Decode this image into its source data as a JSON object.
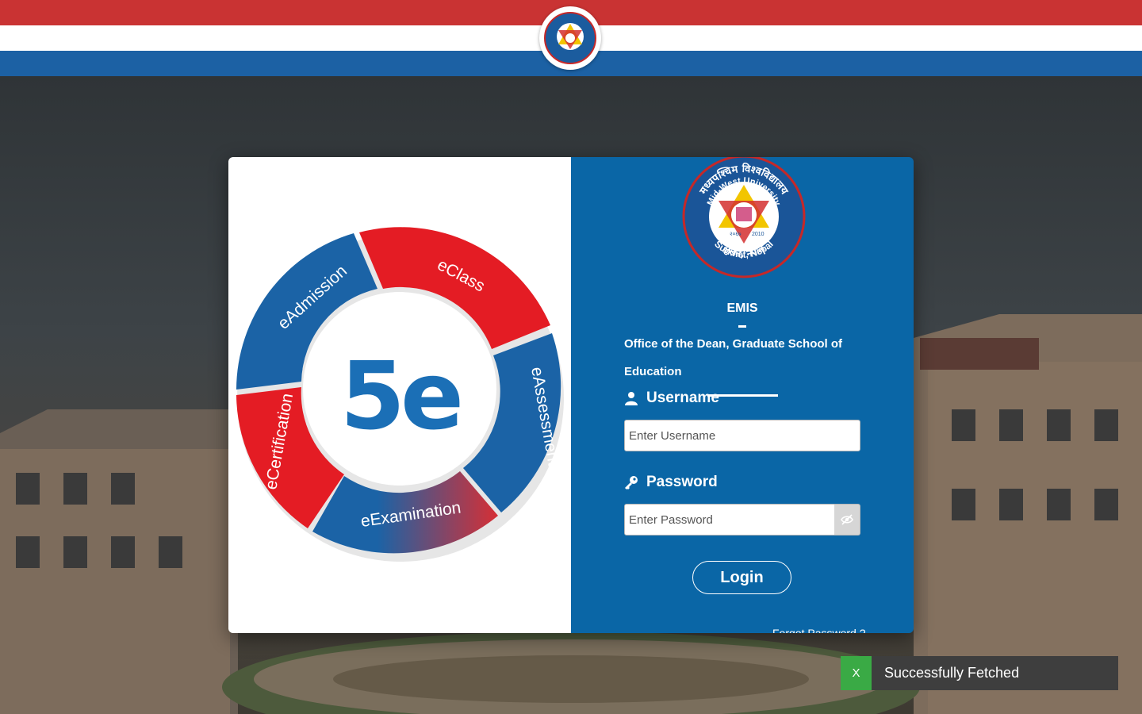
{
  "header": {
    "logo_icon": "university-seal-icon",
    "colors": {
      "red": "#c93333",
      "white": "#ffffff",
      "blue": "#1c61a4"
    }
  },
  "promo": {
    "center_text": "5e",
    "segments": [
      "eClass",
      "eAssessment",
      "eExamination",
      "eCertification",
      "eAdmission"
    ],
    "colors": {
      "red": "#e41c24",
      "blue": "#1b63a6"
    }
  },
  "login": {
    "logo": {
      "name_devanagari": "मध्यपश्चिम विश्वविद्यालय",
      "name_english": "Mid-West University",
      "location_devanagari": "सुर्खेत, नेपाल",
      "location_english": "Surkhet, Nepal",
      "year_bs": "२०६७",
      "year_ad": "2010"
    },
    "title": "EMIS",
    "office": "Office of the Dean, Graduate School of Education",
    "username_label": "Username",
    "username_placeholder": "Enter Username",
    "username_value": "",
    "password_label": "Password",
    "password_placeholder": "Enter Password",
    "password_value": "",
    "login_label": "Login",
    "forgot_label": "Forgot Password ?",
    "icons": {
      "user": "user-icon",
      "password": "key-icon",
      "toggle": "eye-slash-icon"
    },
    "panel_color": "#0a66a6"
  },
  "toast": {
    "close_label": "X",
    "message": "Successfully Fetched",
    "accent": "#3aaa45"
  }
}
